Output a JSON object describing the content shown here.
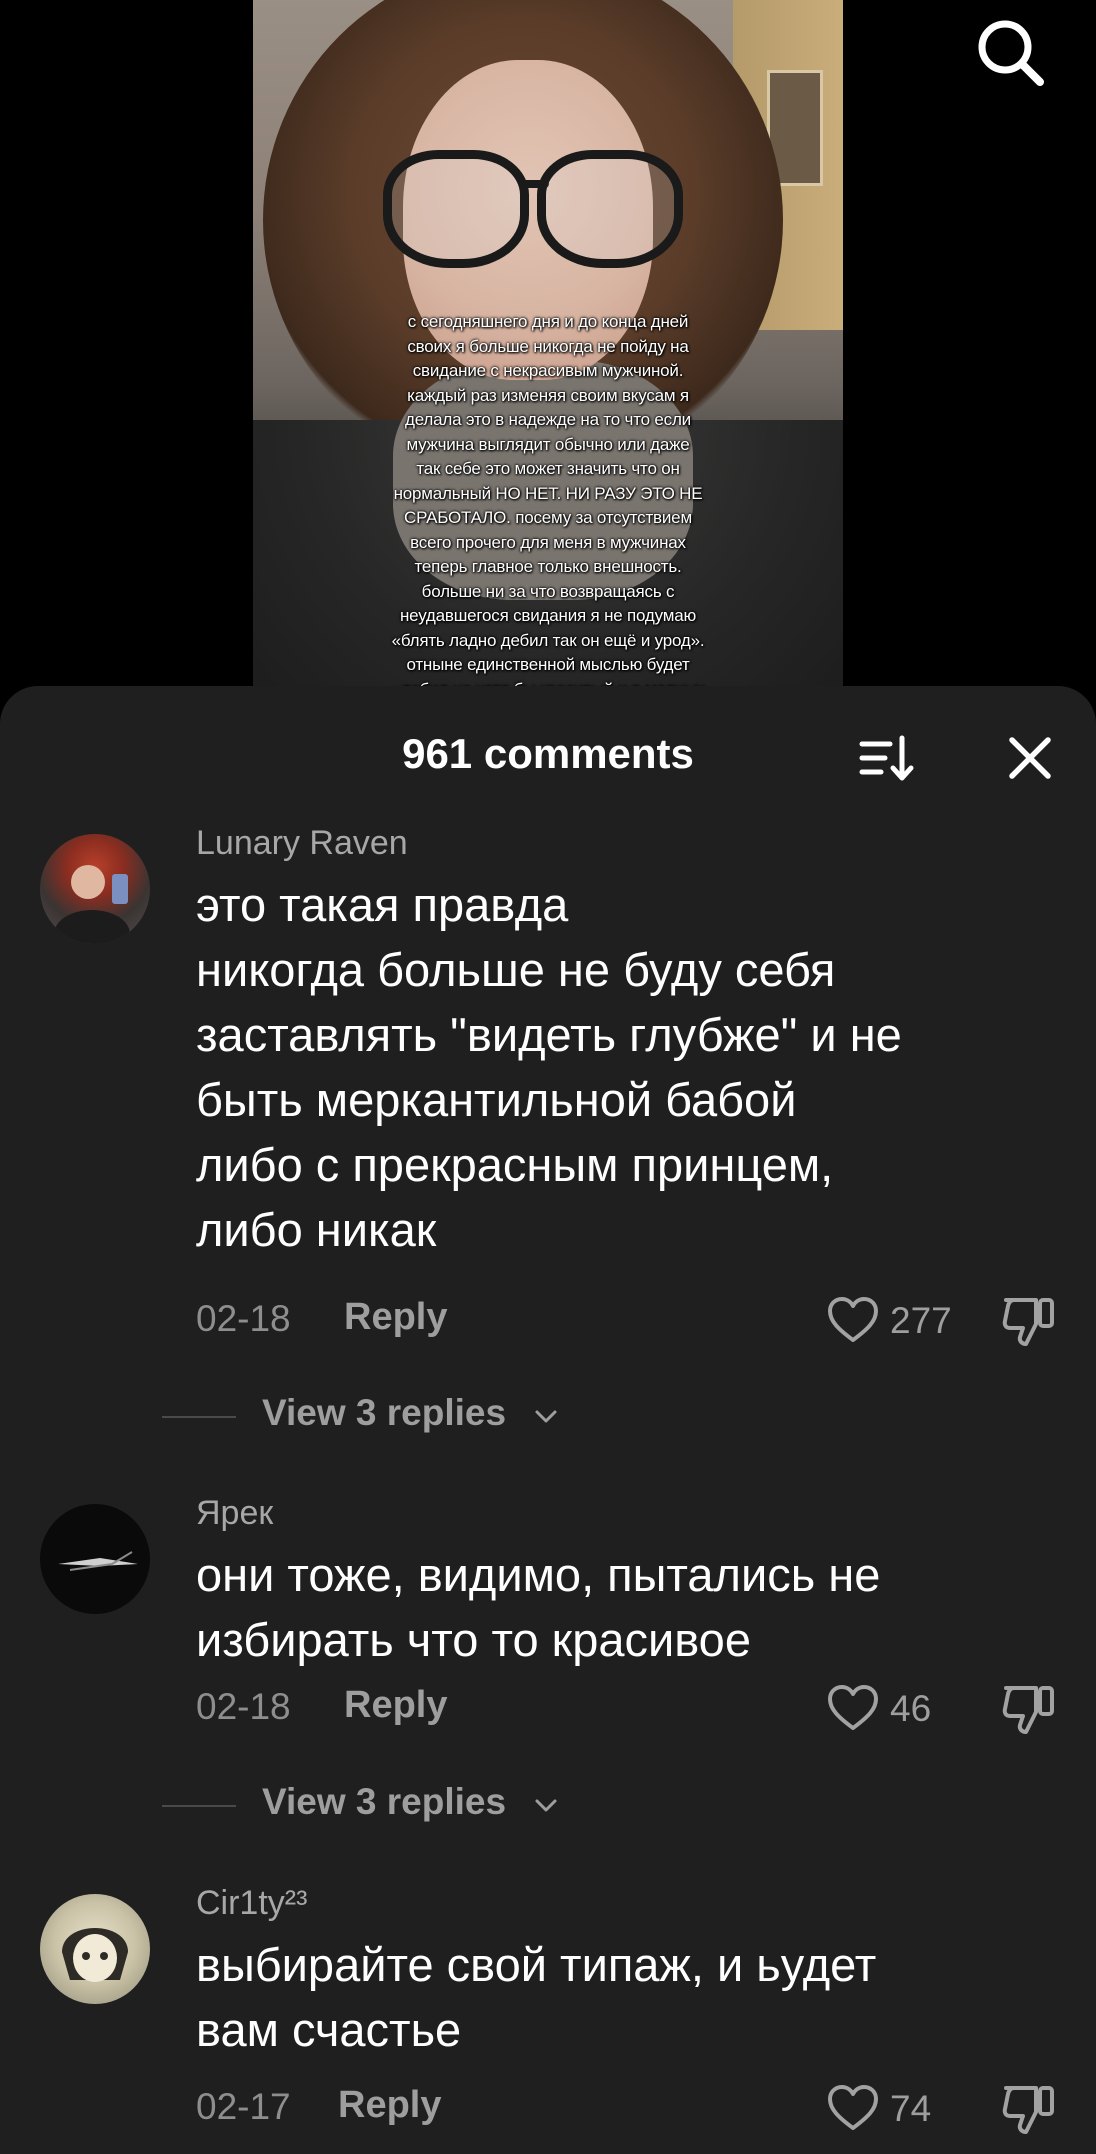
{
  "video": {
    "overlay_text": "с сегодняшнего дня и до конца дней\nсвоих я больше никогда не пойду на\nсвидание с некрасивым мужчиной.\nкаждый раз изменяя своим вкусам я\nделала это в надежде на то что если\nмужчина выглядит обычно или даже\nтак себе это может значить что он\nнормальный НО НЕТ. НИ РАЗУ ЭТО НЕ\nСРАБОТАЛО. посему за отсутствием\nвсего прочего для меня в мужчинах\nтеперь главное только внешность.\nбольше ни за что возвращаясь с\nнеудавшегося свидания я не подумаю\n«блять ладно дебил так он ещё и урод».\nотныне единственной мыслью будет\n«дебил но хотя бы красивый и в модных"
  },
  "header": {
    "comment_count": "961 comments"
  },
  "icons": {
    "search": "search-icon",
    "sort": "sort-icon",
    "close": "close-icon",
    "like": "heart-icon",
    "dislike": "thumbs-down-icon"
  },
  "comments": [
    {
      "username": "Lunary Raven",
      "text": "это такая правда\nникогда больше не буду себя\nзаставлять \"видеть глубже\" и не\nбыть меркантильной бабой\nлибо с прекрасным принцем,\nлибо никак",
      "date": "02-18",
      "reply_label": "Reply",
      "likes": "277",
      "view_replies": "View 3 replies"
    },
    {
      "username": "Ярек",
      "text": "они тоже, видимо, пытались не\nизбирать что то красивое",
      "date": "02-18",
      "reply_label": "Reply",
      "likes": "46",
      "view_replies": "View 3 replies"
    },
    {
      "username": "Cir1ty²³",
      "text": "выбирайте свой типаж, и ьудет\nвам счастье",
      "date": "02-17",
      "reply_label": "Reply",
      "likes": "74"
    }
  ]
}
